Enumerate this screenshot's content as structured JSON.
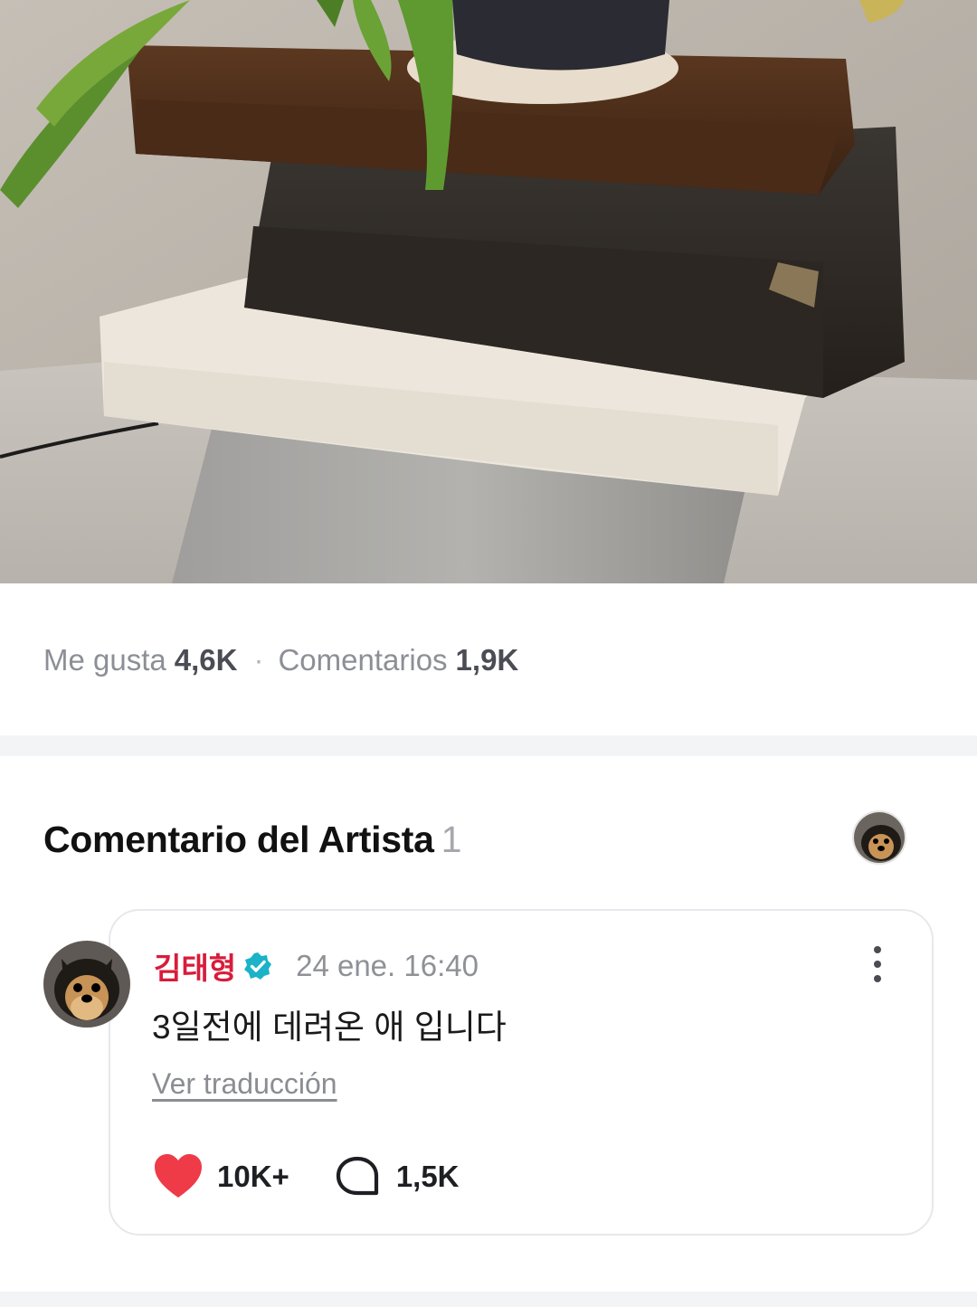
{
  "post": {
    "image_alt_icon": "plant-photo",
    "likes_label": "Me gusta",
    "likes_count": "4,6K",
    "separator": "·",
    "comments_label": "Comentarios",
    "comments_count": "1,9K"
  },
  "artist_comments": {
    "title": "Comentario del Artista",
    "count": "1",
    "header_avatar_icon": "artist-avatar"
  },
  "comment": {
    "author": "김태형",
    "verified_icon": "verified-badge-icon",
    "timestamp": "24 ene. 16:40",
    "text": "3일전에 데려온 애 입니다",
    "translate_link": "Ver traducción",
    "like_count": "10K+",
    "reply_count": "1,5K",
    "colors": {
      "author": "#d81c3a",
      "heart": "#ee3b47",
      "badge": "#1ab3c8"
    }
  }
}
